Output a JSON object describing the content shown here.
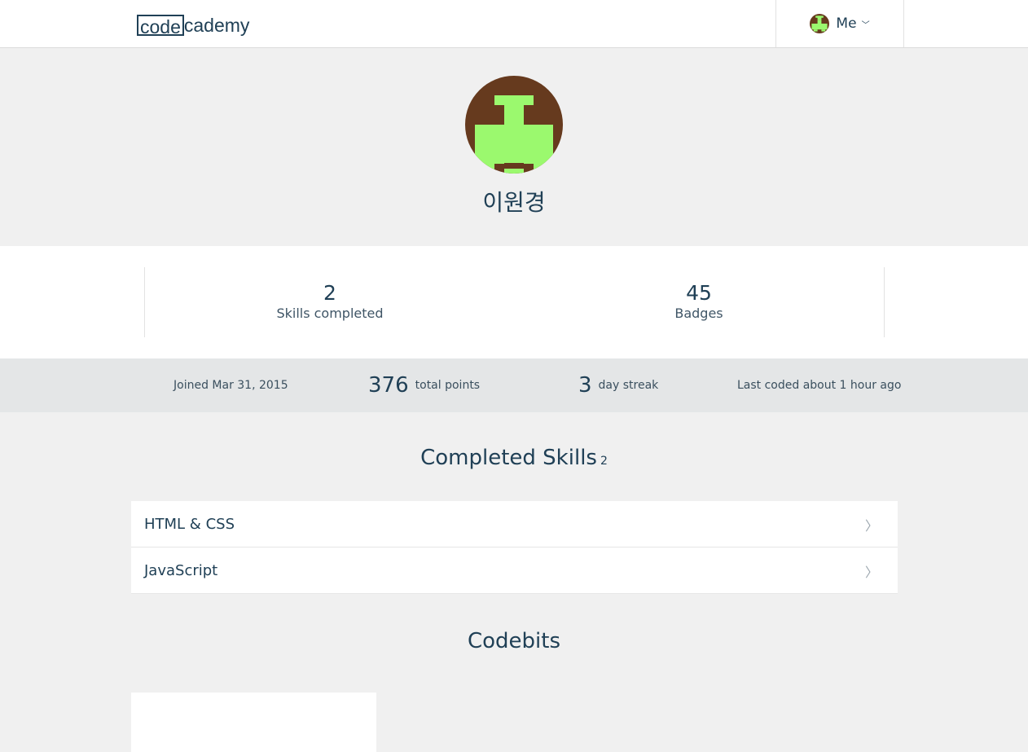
{
  "header": {
    "logo_boxed": "code",
    "logo_rest": "cademy",
    "me_label": "Me",
    "me_chevron": "﹀"
  },
  "profile": {
    "username": "이원경",
    "avatar_colors": {
      "background": "#663a1e",
      "foreground": "#9bf96e"
    }
  },
  "stats": [
    {
      "value": "2",
      "label": "Skills completed"
    },
    {
      "value": "45",
      "label": "Badges"
    }
  ],
  "meta": {
    "joined": "Joined Mar 31, 2015",
    "points_value": "376",
    "points_label": "total points",
    "streak_value": "3",
    "streak_label": "day streak",
    "last_coded": "Last coded about 1 hour ago"
  },
  "completed_skills": {
    "title": "Completed Skills",
    "count": "2",
    "items": [
      {
        "name": "HTML & CSS",
        "arrow": "〉"
      },
      {
        "name": "JavaScript",
        "arrow": "〉"
      }
    ]
  },
  "codebits": {
    "title": "Codebits"
  },
  "colors": {
    "text": "#204056",
    "page_bg": "#f0f0f0",
    "meta_bg": "#e4e6e7"
  }
}
